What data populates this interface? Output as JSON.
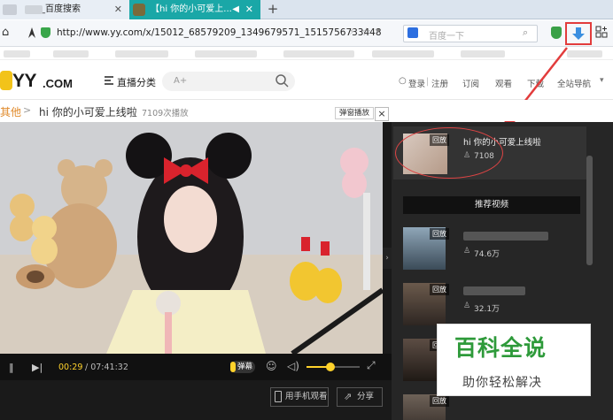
{
  "browser": {
    "tabs": [
      {
        "label": "_百度搜索",
        "active": false
      },
      {
        "label": "【hi 你的小可爱上...",
        "active": true
      }
    ],
    "new_tab": "+",
    "address": "http://www.yy.com/x/15012_68579209_1349679571_1515756733448",
    "search_placeholder": "百度一下"
  },
  "site": {
    "logo_yy": "YY",
    "logo_com": ".COM",
    "category_menu": "直播分类",
    "search_placeholder": "A+",
    "nav": [
      {
        "label": "登录"
      },
      {
        "label": "注册"
      },
      {
        "label": "订阅"
      },
      {
        "label": "观看"
      },
      {
        "label": "下载"
      },
      {
        "label": "全站导航"
      }
    ]
  },
  "breadcrumb": {
    "category": "其他",
    "separator": ">",
    "title": "hi 你的小可爱上线啦",
    "views": "7109次播放",
    "danmu_button": "弹窗播放",
    "close": "×"
  },
  "player": {
    "current_time": "00:29",
    "total_time": "/ 07:41:32",
    "danmu_label": "弹幕",
    "volume_level": 0.45,
    "mobile_watch": "用手机观看",
    "share": "分享"
  },
  "sidebar": {
    "current": {
      "badge": "回放",
      "title": "hi 你的小可爱上线啦",
      "views": "7108"
    },
    "recommend_label": "推荐视频",
    "items": [
      {
        "badge": "回放",
        "views": "74.6万"
      },
      {
        "badge": "回放",
        "views": "32.1万"
      },
      {
        "badge": "回放",
        "views": ""
      },
      {
        "badge": "回放",
        "views": ""
      }
    ]
  },
  "watermark": {
    "title": "百科全说",
    "subtitle": "助你轻松解决"
  },
  "colors": {
    "accent": "#ffd22b",
    "active_tab": "#1aa7a7",
    "annotation_red": "#e23c3c",
    "watermark_green": "#2e9a3a"
  }
}
